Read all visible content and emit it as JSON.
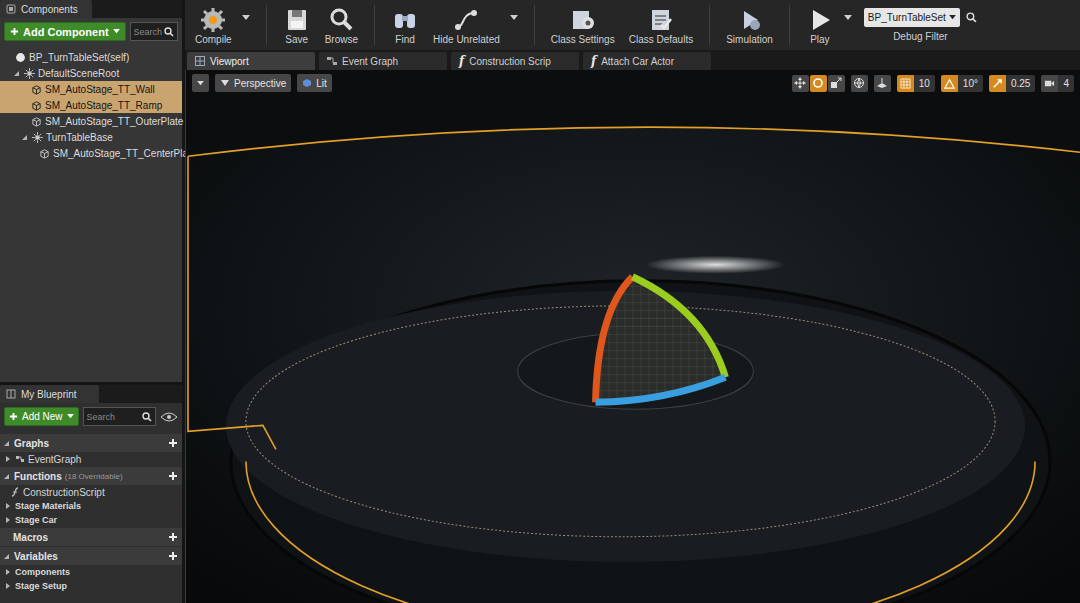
{
  "components_panel": {
    "title": "Components",
    "add_button": "Add Component",
    "search_placeholder": "Search",
    "tree": [
      {
        "label": "BP_TurnTableSet(self)",
        "depth": 0,
        "kind": "self",
        "expanded": false,
        "selected": false
      },
      {
        "label": "DefaultSceneRoot",
        "depth": 1,
        "kind": "group",
        "expanded": true,
        "selected": false
      },
      {
        "label": "SM_AutoStage_TT_Wall",
        "depth": 2,
        "kind": "mesh",
        "expanded": false,
        "selected": true
      },
      {
        "label": "SM_AutoStage_TT_Ramp",
        "depth": 2,
        "kind": "mesh",
        "expanded": false,
        "selected": true
      },
      {
        "label": "SM_AutoStage_TT_OuterPlate",
        "depth": 2,
        "kind": "mesh",
        "expanded": false,
        "selected": false
      },
      {
        "label": "TurnTableBase",
        "depth": 2,
        "kind": "group",
        "expanded": true,
        "selected": false
      },
      {
        "label": "SM_AutoStage_TT_CenterPla",
        "depth": 3,
        "kind": "mesh",
        "expanded": false,
        "selected": false
      }
    ]
  },
  "my_blueprint": {
    "title": "My Blueprint",
    "add_button": "Add New",
    "search_placeholder": "Search",
    "sections": [
      {
        "label": "Graphs",
        "expanded": true,
        "items": [
          {
            "label": "EventGraph",
            "kind": "graph",
            "expanded": false
          }
        ]
      },
      {
        "label": "Functions",
        "count": "(18 Overridable)",
        "expanded": true,
        "items": [
          {
            "label": "ConstructionScript",
            "kind": "function",
            "expanded": false
          },
          {
            "label": "Stage Materials",
            "kind": "category",
            "expanded": false
          },
          {
            "label": "Stage Car",
            "kind": "category",
            "expanded": false
          }
        ]
      },
      {
        "label": "Macros",
        "expanded": false,
        "items": []
      },
      {
        "label": "Variables",
        "expanded": true,
        "items": [
          {
            "label": "Components",
            "kind": "category",
            "expanded": false
          },
          {
            "label": "Stage Setup",
            "kind": "category",
            "expanded": false
          }
        ]
      }
    ]
  },
  "toolbar": {
    "buttons": [
      {
        "label": "Compile",
        "dropdown": true
      },
      {
        "label": "Save",
        "dropdown": false
      },
      {
        "label": "Browse",
        "dropdown": false
      },
      {
        "label": "Find",
        "dropdown": false
      },
      {
        "label": "Hide Unrelated",
        "dropdown": true
      },
      {
        "label": "Class Settings",
        "dropdown": false
      },
      {
        "label": "Class Defaults",
        "dropdown": false
      },
      {
        "label": "Simulation",
        "dropdown": false
      },
      {
        "label": "Play",
        "dropdown": true
      }
    ],
    "debug_filter": {
      "value": "BP_TurnTableSet",
      "label": "Debug Filter"
    }
  },
  "tabs": [
    {
      "label": "Viewport",
      "kind": "viewport",
      "selected": true
    },
    {
      "label": "Event Graph",
      "kind": "graph",
      "selected": false
    },
    {
      "label": "Construction Scrip",
      "kind": "function",
      "glyph": "f",
      "selected": false
    },
    {
      "label": "Attach Car Actor",
      "kind": "function",
      "glyph": "f",
      "selected": false
    }
  ],
  "viewport_toolbar": {
    "view_mode": "Perspective",
    "lighting": "Lit",
    "transform_tools": [
      {
        "selected": false
      },
      {
        "selected": true
      },
      {
        "selected": false
      }
    ],
    "snaps": [
      {
        "value": "10",
        "active": true
      },
      {
        "value": "10°",
        "active": true
      },
      {
        "value": "0.25",
        "active": true
      }
    ],
    "camera_speed": "4"
  }
}
